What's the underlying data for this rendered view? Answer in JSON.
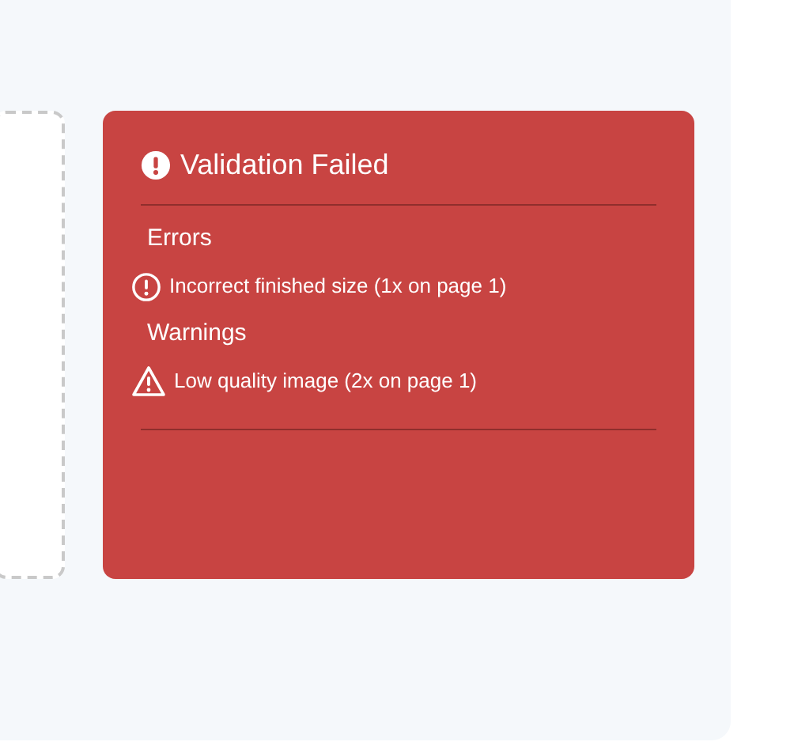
{
  "card": {
    "title": "Validation Failed",
    "sections": [
      {
        "heading": "Errors",
        "items": [
          {
            "kind": "error",
            "text": "Incorrect finished size (1x on page 1)"
          }
        ]
      },
      {
        "heading": "Warnings",
        "items": [
          {
            "kind": "warning",
            "text": "Low quality image (2x on page 1)"
          }
        ]
      }
    ]
  }
}
